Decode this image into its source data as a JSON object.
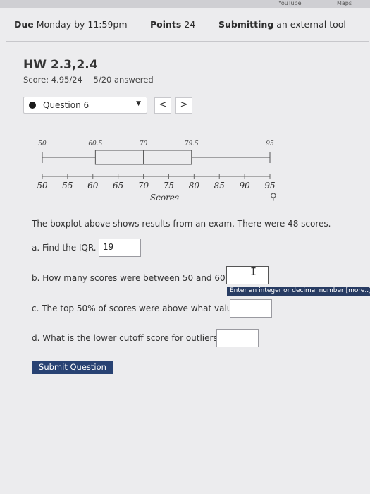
{
  "browser_tabs": {
    "youtube": "YouTube",
    "maps": "Maps"
  },
  "meta": {
    "due_label": "Due",
    "due_value": "Monday by 11:59pm",
    "points_label": "Points",
    "points_value": "24",
    "submitting_label": "Submitting",
    "submitting_value": "an external tool"
  },
  "hw": {
    "title": "HW 2.3,2.4",
    "score": "Score: 4.95/24",
    "answered": "5/20 answered"
  },
  "question_select": {
    "label": "Question 6"
  },
  "nav": {
    "prev": "<",
    "next": ">"
  },
  "chart_data": {
    "type": "boxplot",
    "min": 50,
    "q1": 60.5,
    "median": 70,
    "q3": 79.5,
    "max": 95,
    "value_labels": [
      "50",
      "60.5",
      "70",
      "79.5",
      "95"
    ],
    "ticks": [
      50,
      55,
      60,
      65,
      70,
      75,
      80,
      85,
      90,
      95
    ],
    "xlim": [
      50,
      95
    ],
    "xlabel": "Scores"
  },
  "prompt": "The boxplot above shows results from an exam. There were 48 scores.",
  "questions": {
    "a": {
      "label": "a. Find the IQR.",
      "value": "19"
    },
    "b": {
      "label": "b. How many scores were between 50 and 60.5?",
      "value": ""
    },
    "c": {
      "label": "c. The top 50% of scores were above what value?",
      "value": ""
    },
    "d": {
      "label": "d. What is the lower cutoff score for outliers?",
      "value": ""
    }
  },
  "tooltip": "Enter an integer or decimal number [more..]",
  "submit_label": "Submit Question"
}
